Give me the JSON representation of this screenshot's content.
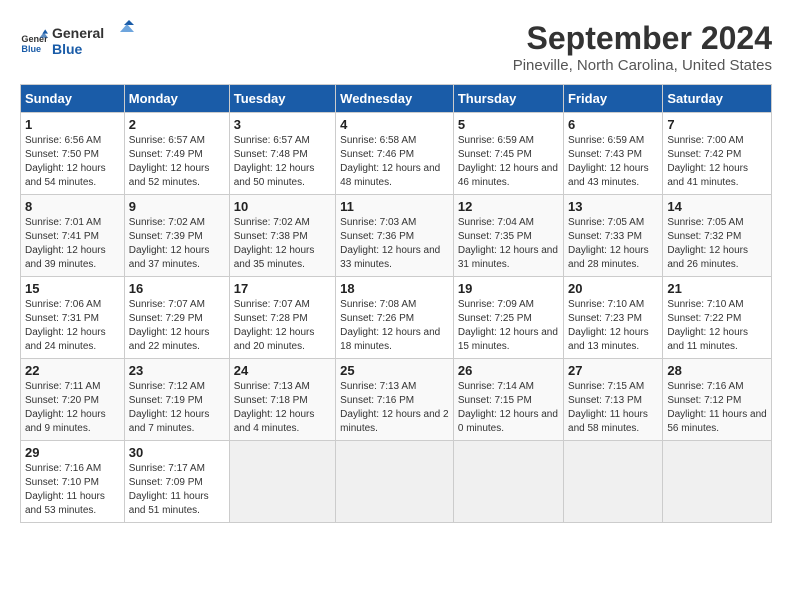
{
  "header": {
    "logo_line1": "General",
    "logo_line2": "Blue",
    "title": "September 2024",
    "subtitle": "Pineville, North Carolina, United States"
  },
  "weekdays": [
    "Sunday",
    "Monday",
    "Tuesday",
    "Wednesday",
    "Thursday",
    "Friday",
    "Saturday"
  ],
  "weeks": [
    [
      {
        "num": "1",
        "sunrise": "6:56 AM",
        "sunset": "7:50 PM",
        "daylight": "12 hours and 54 minutes."
      },
      {
        "num": "2",
        "sunrise": "6:57 AM",
        "sunset": "7:49 PM",
        "daylight": "12 hours and 52 minutes."
      },
      {
        "num": "3",
        "sunrise": "6:57 AM",
        "sunset": "7:48 PM",
        "daylight": "12 hours and 50 minutes."
      },
      {
        "num": "4",
        "sunrise": "6:58 AM",
        "sunset": "7:46 PM",
        "daylight": "12 hours and 48 minutes."
      },
      {
        "num": "5",
        "sunrise": "6:59 AM",
        "sunset": "7:45 PM",
        "daylight": "12 hours and 46 minutes."
      },
      {
        "num": "6",
        "sunrise": "6:59 AM",
        "sunset": "7:43 PM",
        "daylight": "12 hours and 43 minutes."
      },
      {
        "num": "7",
        "sunrise": "7:00 AM",
        "sunset": "7:42 PM",
        "daylight": "12 hours and 41 minutes."
      }
    ],
    [
      {
        "num": "8",
        "sunrise": "7:01 AM",
        "sunset": "7:41 PM",
        "daylight": "12 hours and 39 minutes."
      },
      {
        "num": "9",
        "sunrise": "7:02 AM",
        "sunset": "7:39 PM",
        "daylight": "12 hours and 37 minutes."
      },
      {
        "num": "10",
        "sunrise": "7:02 AM",
        "sunset": "7:38 PM",
        "daylight": "12 hours and 35 minutes."
      },
      {
        "num": "11",
        "sunrise": "7:03 AM",
        "sunset": "7:36 PM",
        "daylight": "12 hours and 33 minutes."
      },
      {
        "num": "12",
        "sunrise": "7:04 AM",
        "sunset": "7:35 PM",
        "daylight": "12 hours and 31 minutes."
      },
      {
        "num": "13",
        "sunrise": "7:05 AM",
        "sunset": "7:33 PM",
        "daylight": "12 hours and 28 minutes."
      },
      {
        "num": "14",
        "sunrise": "7:05 AM",
        "sunset": "7:32 PM",
        "daylight": "12 hours and 26 minutes."
      }
    ],
    [
      {
        "num": "15",
        "sunrise": "7:06 AM",
        "sunset": "7:31 PM",
        "daylight": "12 hours and 24 minutes."
      },
      {
        "num": "16",
        "sunrise": "7:07 AM",
        "sunset": "7:29 PM",
        "daylight": "12 hours and 22 minutes."
      },
      {
        "num": "17",
        "sunrise": "7:07 AM",
        "sunset": "7:28 PM",
        "daylight": "12 hours and 20 minutes."
      },
      {
        "num": "18",
        "sunrise": "7:08 AM",
        "sunset": "7:26 PM",
        "daylight": "12 hours and 18 minutes."
      },
      {
        "num": "19",
        "sunrise": "7:09 AM",
        "sunset": "7:25 PM",
        "daylight": "12 hours and 15 minutes."
      },
      {
        "num": "20",
        "sunrise": "7:10 AM",
        "sunset": "7:23 PM",
        "daylight": "12 hours and 13 minutes."
      },
      {
        "num": "21",
        "sunrise": "7:10 AM",
        "sunset": "7:22 PM",
        "daylight": "12 hours and 11 minutes."
      }
    ],
    [
      {
        "num": "22",
        "sunrise": "7:11 AM",
        "sunset": "7:20 PM",
        "daylight": "12 hours and 9 minutes."
      },
      {
        "num": "23",
        "sunrise": "7:12 AM",
        "sunset": "7:19 PM",
        "daylight": "12 hours and 7 minutes."
      },
      {
        "num": "24",
        "sunrise": "7:13 AM",
        "sunset": "7:18 PM",
        "daylight": "12 hours and 4 minutes."
      },
      {
        "num": "25",
        "sunrise": "7:13 AM",
        "sunset": "7:16 PM",
        "daylight": "12 hours and 2 minutes."
      },
      {
        "num": "26",
        "sunrise": "7:14 AM",
        "sunset": "7:15 PM",
        "daylight": "12 hours and 0 minutes."
      },
      {
        "num": "27",
        "sunrise": "7:15 AM",
        "sunset": "7:13 PM",
        "daylight": "11 hours and 58 minutes."
      },
      {
        "num": "28",
        "sunrise": "7:16 AM",
        "sunset": "7:12 PM",
        "daylight": "11 hours and 56 minutes."
      }
    ],
    [
      {
        "num": "29",
        "sunrise": "7:16 AM",
        "sunset": "7:10 PM",
        "daylight": "11 hours and 53 minutes."
      },
      {
        "num": "30",
        "sunrise": "7:17 AM",
        "sunset": "7:09 PM",
        "daylight": "11 hours and 51 minutes."
      },
      null,
      null,
      null,
      null,
      null
    ]
  ],
  "labels": {
    "sunrise": "Sunrise:",
    "sunset": "Sunset:",
    "daylight": "Daylight:"
  }
}
